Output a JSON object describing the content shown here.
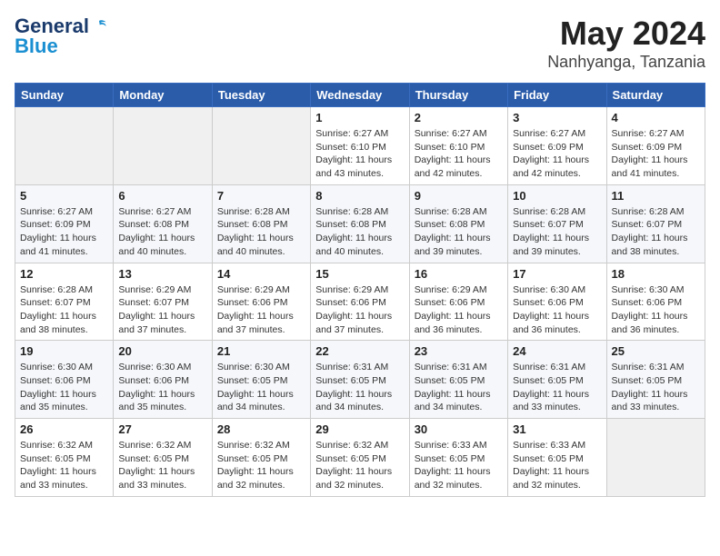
{
  "logo": {
    "general": "General",
    "blue": "Blue"
  },
  "title": "May 2024",
  "subtitle": "Nanhyanga, Tanzania",
  "days_of_week": [
    "Sunday",
    "Monday",
    "Tuesday",
    "Wednesday",
    "Thursday",
    "Friday",
    "Saturday"
  ],
  "weeks": [
    [
      {
        "day": "",
        "info": ""
      },
      {
        "day": "",
        "info": ""
      },
      {
        "day": "",
        "info": ""
      },
      {
        "day": "1",
        "info": "Sunrise: 6:27 AM\nSunset: 6:10 PM\nDaylight: 11 hours\nand 43 minutes."
      },
      {
        "day": "2",
        "info": "Sunrise: 6:27 AM\nSunset: 6:10 PM\nDaylight: 11 hours\nand 42 minutes."
      },
      {
        "day": "3",
        "info": "Sunrise: 6:27 AM\nSunset: 6:09 PM\nDaylight: 11 hours\nand 42 minutes."
      },
      {
        "day": "4",
        "info": "Sunrise: 6:27 AM\nSunset: 6:09 PM\nDaylight: 11 hours\nand 41 minutes."
      }
    ],
    [
      {
        "day": "5",
        "info": "Sunrise: 6:27 AM\nSunset: 6:09 PM\nDaylight: 11 hours\nand 41 minutes."
      },
      {
        "day": "6",
        "info": "Sunrise: 6:27 AM\nSunset: 6:08 PM\nDaylight: 11 hours\nand 40 minutes."
      },
      {
        "day": "7",
        "info": "Sunrise: 6:28 AM\nSunset: 6:08 PM\nDaylight: 11 hours\nand 40 minutes."
      },
      {
        "day": "8",
        "info": "Sunrise: 6:28 AM\nSunset: 6:08 PM\nDaylight: 11 hours\nand 40 minutes."
      },
      {
        "day": "9",
        "info": "Sunrise: 6:28 AM\nSunset: 6:08 PM\nDaylight: 11 hours\nand 39 minutes."
      },
      {
        "day": "10",
        "info": "Sunrise: 6:28 AM\nSunset: 6:07 PM\nDaylight: 11 hours\nand 39 minutes."
      },
      {
        "day": "11",
        "info": "Sunrise: 6:28 AM\nSunset: 6:07 PM\nDaylight: 11 hours\nand 38 minutes."
      }
    ],
    [
      {
        "day": "12",
        "info": "Sunrise: 6:28 AM\nSunset: 6:07 PM\nDaylight: 11 hours\nand 38 minutes."
      },
      {
        "day": "13",
        "info": "Sunrise: 6:29 AM\nSunset: 6:07 PM\nDaylight: 11 hours\nand 37 minutes."
      },
      {
        "day": "14",
        "info": "Sunrise: 6:29 AM\nSunset: 6:06 PM\nDaylight: 11 hours\nand 37 minutes."
      },
      {
        "day": "15",
        "info": "Sunrise: 6:29 AM\nSunset: 6:06 PM\nDaylight: 11 hours\nand 37 minutes."
      },
      {
        "day": "16",
        "info": "Sunrise: 6:29 AM\nSunset: 6:06 PM\nDaylight: 11 hours\nand 36 minutes."
      },
      {
        "day": "17",
        "info": "Sunrise: 6:30 AM\nSunset: 6:06 PM\nDaylight: 11 hours\nand 36 minutes."
      },
      {
        "day": "18",
        "info": "Sunrise: 6:30 AM\nSunset: 6:06 PM\nDaylight: 11 hours\nand 36 minutes."
      }
    ],
    [
      {
        "day": "19",
        "info": "Sunrise: 6:30 AM\nSunset: 6:06 PM\nDaylight: 11 hours\nand 35 minutes."
      },
      {
        "day": "20",
        "info": "Sunrise: 6:30 AM\nSunset: 6:06 PM\nDaylight: 11 hours\nand 35 minutes."
      },
      {
        "day": "21",
        "info": "Sunrise: 6:30 AM\nSunset: 6:05 PM\nDaylight: 11 hours\nand 34 minutes."
      },
      {
        "day": "22",
        "info": "Sunrise: 6:31 AM\nSunset: 6:05 PM\nDaylight: 11 hours\nand 34 minutes."
      },
      {
        "day": "23",
        "info": "Sunrise: 6:31 AM\nSunset: 6:05 PM\nDaylight: 11 hours\nand 34 minutes."
      },
      {
        "day": "24",
        "info": "Sunrise: 6:31 AM\nSunset: 6:05 PM\nDaylight: 11 hours\nand 33 minutes."
      },
      {
        "day": "25",
        "info": "Sunrise: 6:31 AM\nSunset: 6:05 PM\nDaylight: 11 hours\nand 33 minutes."
      }
    ],
    [
      {
        "day": "26",
        "info": "Sunrise: 6:32 AM\nSunset: 6:05 PM\nDaylight: 11 hours\nand 33 minutes."
      },
      {
        "day": "27",
        "info": "Sunrise: 6:32 AM\nSunset: 6:05 PM\nDaylight: 11 hours\nand 33 minutes."
      },
      {
        "day": "28",
        "info": "Sunrise: 6:32 AM\nSunset: 6:05 PM\nDaylight: 11 hours\nand 32 minutes."
      },
      {
        "day": "29",
        "info": "Sunrise: 6:32 AM\nSunset: 6:05 PM\nDaylight: 11 hours\nand 32 minutes."
      },
      {
        "day": "30",
        "info": "Sunrise: 6:33 AM\nSunset: 6:05 PM\nDaylight: 11 hours\nand 32 minutes."
      },
      {
        "day": "31",
        "info": "Sunrise: 6:33 AM\nSunset: 6:05 PM\nDaylight: 11 hours\nand 32 minutes."
      },
      {
        "day": "",
        "info": ""
      }
    ]
  ]
}
